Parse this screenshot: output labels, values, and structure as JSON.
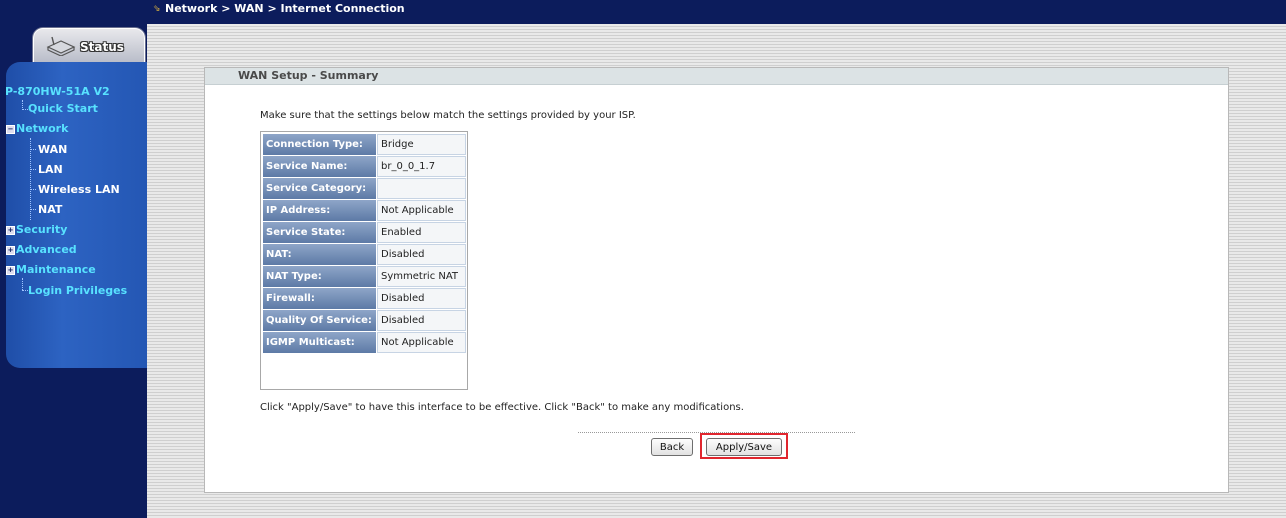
{
  "breadcrumb": "Network > WAN > Internet Connection",
  "sidebar": {
    "status_tab": "Status",
    "model": "P-870HW-51A V2",
    "items": [
      {
        "label": "Quick Start"
      },
      {
        "label": "Network"
      },
      {
        "label": "WAN"
      },
      {
        "label": "LAN"
      },
      {
        "label": "Wireless LAN"
      },
      {
        "label": "NAT"
      },
      {
        "label": "Security"
      },
      {
        "label": "Advanced"
      },
      {
        "label": "Maintenance"
      },
      {
        "label": "Login Privileges"
      }
    ]
  },
  "main": {
    "section_title": "WAN Setup - Summary",
    "intro": "Make sure that the settings below match the settings provided by your ISP.",
    "summary": [
      {
        "key": "Connection Type:",
        "value": "Bridge"
      },
      {
        "key": "Service Name:",
        "value": "br_0_0_1.7"
      },
      {
        "key": "Service Category:",
        "value": ""
      },
      {
        "key": "IP Address:",
        "value": "Not Applicable"
      },
      {
        "key": "Service State:",
        "value": "Enabled"
      },
      {
        "key": "NAT:",
        "value": "Disabled"
      },
      {
        "key": "NAT Type:",
        "value": "Symmetric NAT"
      },
      {
        "key": "Firewall:",
        "value": "Disabled"
      },
      {
        "key": "Quality Of Service:",
        "value": "Disabled"
      },
      {
        "key": "IGMP Multicast:",
        "value": "Not Applicable"
      }
    ],
    "footer": "Click \"Apply/Save\" to have this interface to be effective. Click \"Back\" to make any modifications.",
    "back_label": "Back",
    "apply_label": "Apply/Save"
  },
  "colors": {
    "nav_dark": "#0c1c5c",
    "menu_blue": "#2d63c2",
    "menu_text": "#58e2ff",
    "highlight": "#e0262e"
  }
}
